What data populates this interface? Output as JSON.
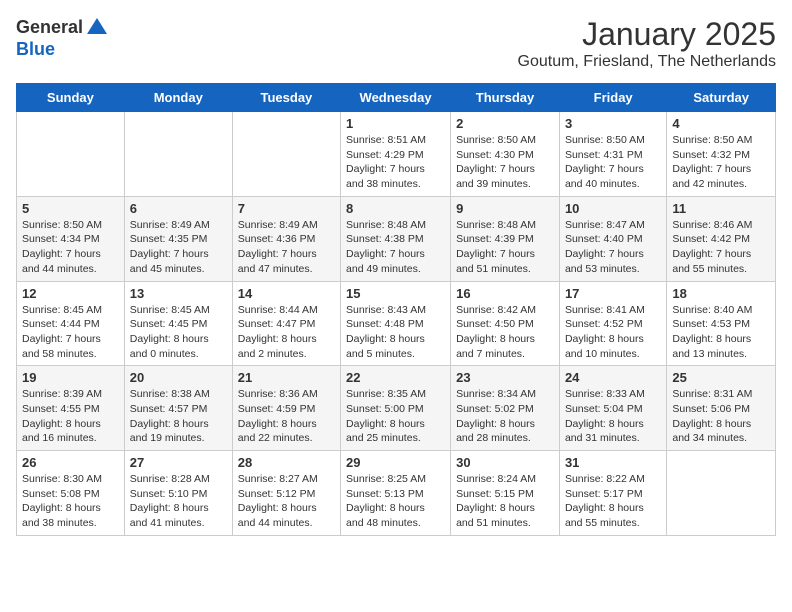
{
  "logo": {
    "general": "General",
    "blue": "Blue"
  },
  "header": {
    "month": "January 2025",
    "location": "Goutum, Friesland, The Netherlands"
  },
  "weekdays": [
    "Sunday",
    "Monday",
    "Tuesday",
    "Wednesday",
    "Thursday",
    "Friday",
    "Saturday"
  ],
  "weeks": [
    [
      {
        "day": "",
        "info": ""
      },
      {
        "day": "",
        "info": ""
      },
      {
        "day": "",
        "info": ""
      },
      {
        "day": "1",
        "info": "Sunrise: 8:51 AM\nSunset: 4:29 PM\nDaylight: 7 hours and 38 minutes."
      },
      {
        "day": "2",
        "info": "Sunrise: 8:50 AM\nSunset: 4:30 PM\nDaylight: 7 hours and 39 minutes."
      },
      {
        "day": "3",
        "info": "Sunrise: 8:50 AM\nSunset: 4:31 PM\nDaylight: 7 hours and 40 minutes."
      },
      {
        "day": "4",
        "info": "Sunrise: 8:50 AM\nSunset: 4:32 PM\nDaylight: 7 hours and 42 minutes."
      }
    ],
    [
      {
        "day": "5",
        "info": "Sunrise: 8:50 AM\nSunset: 4:34 PM\nDaylight: 7 hours and 44 minutes."
      },
      {
        "day": "6",
        "info": "Sunrise: 8:49 AM\nSunset: 4:35 PM\nDaylight: 7 hours and 45 minutes."
      },
      {
        "day": "7",
        "info": "Sunrise: 8:49 AM\nSunset: 4:36 PM\nDaylight: 7 hours and 47 minutes."
      },
      {
        "day": "8",
        "info": "Sunrise: 8:48 AM\nSunset: 4:38 PM\nDaylight: 7 hours and 49 minutes."
      },
      {
        "day": "9",
        "info": "Sunrise: 8:48 AM\nSunset: 4:39 PM\nDaylight: 7 hours and 51 minutes."
      },
      {
        "day": "10",
        "info": "Sunrise: 8:47 AM\nSunset: 4:40 PM\nDaylight: 7 hours and 53 minutes."
      },
      {
        "day": "11",
        "info": "Sunrise: 8:46 AM\nSunset: 4:42 PM\nDaylight: 7 hours and 55 minutes."
      }
    ],
    [
      {
        "day": "12",
        "info": "Sunrise: 8:45 AM\nSunset: 4:44 PM\nDaylight: 7 hours and 58 minutes."
      },
      {
        "day": "13",
        "info": "Sunrise: 8:45 AM\nSunset: 4:45 PM\nDaylight: 8 hours and 0 minutes."
      },
      {
        "day": "14",
        "info": "Sunrise: 8:44 AM\nSunset: 4:47 PM\nDaylight: 8 hours and 2 minutes."
      },
      {
        "day": "15",
        "info": "Sunrise: 8:43 AM\nSunset: 4:48 PM\nDaylight: 8 hours and 5 minutes."
      },
      {
        "day": "16",
        "info": "Sunrise: 8:42 AM\nSunset: 4:50 PM\nDaylight: 8 hours and 7 minutes."
      },
      {
        "day": "17",
        "info": "Sunrise: 8:41 AM\nSunset: 4:52 PM\nDaylight: 8 hours and 10 minutes."
      },
      {
        "day": "18",
        "info": "Sunrise: 8:40 AM\nSunset: 4:53 PM\nDaylight: 8 hours and 13 minutes."
      }
    ],
    [
      {
        "day": "19",
        "info": "Sunrise: 8:39 AM\nSunset: 4:55 PM\nDaylight: 8 hours and 16 minutes."
      },
      {
        "day": "20",
        "info": "Sunrise: 8:38 AM\nSunset: 4:57 PM\nDaylight: 8 hours and 19 minutes."
      },
      {
        "day": "21",
        "info": "Sunrise: 8:36 AM\nSunset: 4:59 PM\nDaylight: 8 hours and 22 minutes."
      },
      {
        "day": "22",
        "info": "Sunrise: 8:35 AM\nSunset: 5:00 PM\nDaylight: 8 hours and 25 minutes."
      },
      {
        "day": "23",
        "info": "Sunrise: 8:34 AM\nSunset: 5:02 PM\nDaylight: 8 hours and 28 minutes."
      },
      {
        "day": "24",
        "info": "Sunrise: 8:33 AM\nSunset: 5:04 PM\nDaylight: 8 hours and 31 minutes."
      },
      {
        "day": "25",
        "info": "Sunrise: 8:31 AM\nSunset: 5:06 PM\nDaylight: 8 hours and 34 minutes."
      }
    ],
    [
      {
        "day": "26",
        "info": "Sunrise: 8:30 AM\nSunset: 5:08 PM\nDaylight: 8 hours and 38 minutes."
      },
      {
        "day": "27",
        "info": "Sunrise: 8:28 AM\nSunset: 5:10 PM\nDaylight: 8 hours and 41 minutes."
      },
      {
        "day": "28",
        "info": "Sunrise: 8:27 AM\nSunset: 5:12 PM\nDaylight: 8 hours and 44 minutes."
      },
      {
        "day": "29",
        "info": "Sunrise: 8:25 AM\nSunset: 5:13 PM\nDaylight: 8 hours and 48 minutes."
      },
      {
        "day": "30",
        "info": "Sunrise: 8:24 AM\nSunset: 5:15 PM\nDaylight: 8 hours and 51 minutes."
      },
      {
        "day": "31",
        "info": "Sunrise: 8:22 AM\nSunset: 5:17 PM\nDaylight: 8 hours and 55 minutes."
      },
      {
        "day": "",
        "info": ""
      }
    ]
  ]
}
